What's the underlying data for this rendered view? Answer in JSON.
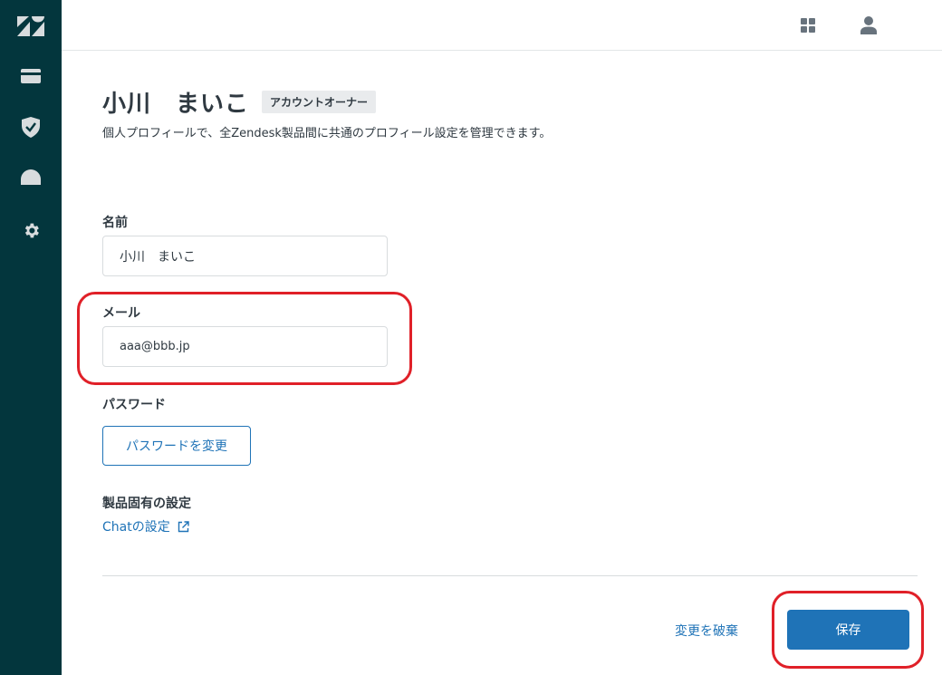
{
  "sidebar": {
    "items": [
      {
        "icon": "zendesk-logo-icon"
      },
      {
        "icon": "credit-card-icon"
      },
      {
        "icon": "shield-check-icon"
      },
      {
        "icon": "dome-icon"
      },
      {
        "icon": "gear-icon"
      }
    ]
  },
  "topbar": {
    "icons": [
      "apps-grid-icon",
      "user-profile-icon"
    ]
  },
  "profile": {
    "name": "小川　まいこ",
    "badge": "アカウントオーナー",
    "description": "個人プロフィールで、全Zendesk製品間に共通のプロフィール設定を管理できます。"
  },
  "form": {
    "name_label": "名前",
    "name_value": "小川　まいこ",
    "email_label": "メール",
    "email_value": "aaa@bbb.jp",
    "password_label": "パスワード",
    "change_password_label": "パスワードを変更",
    "product_settings_label": "製品固有の設定",
    "chat_settings_link": "Chatの設定"
  },
  "footer": {
    "discard_label": "変更を破棄",
    "save_label": "保存"
  },
  "colors": {
    "sidebar_bg": "#03363d",
    "primary": "#1f73b7",
    "highlight": "#e02028"
  }
}
